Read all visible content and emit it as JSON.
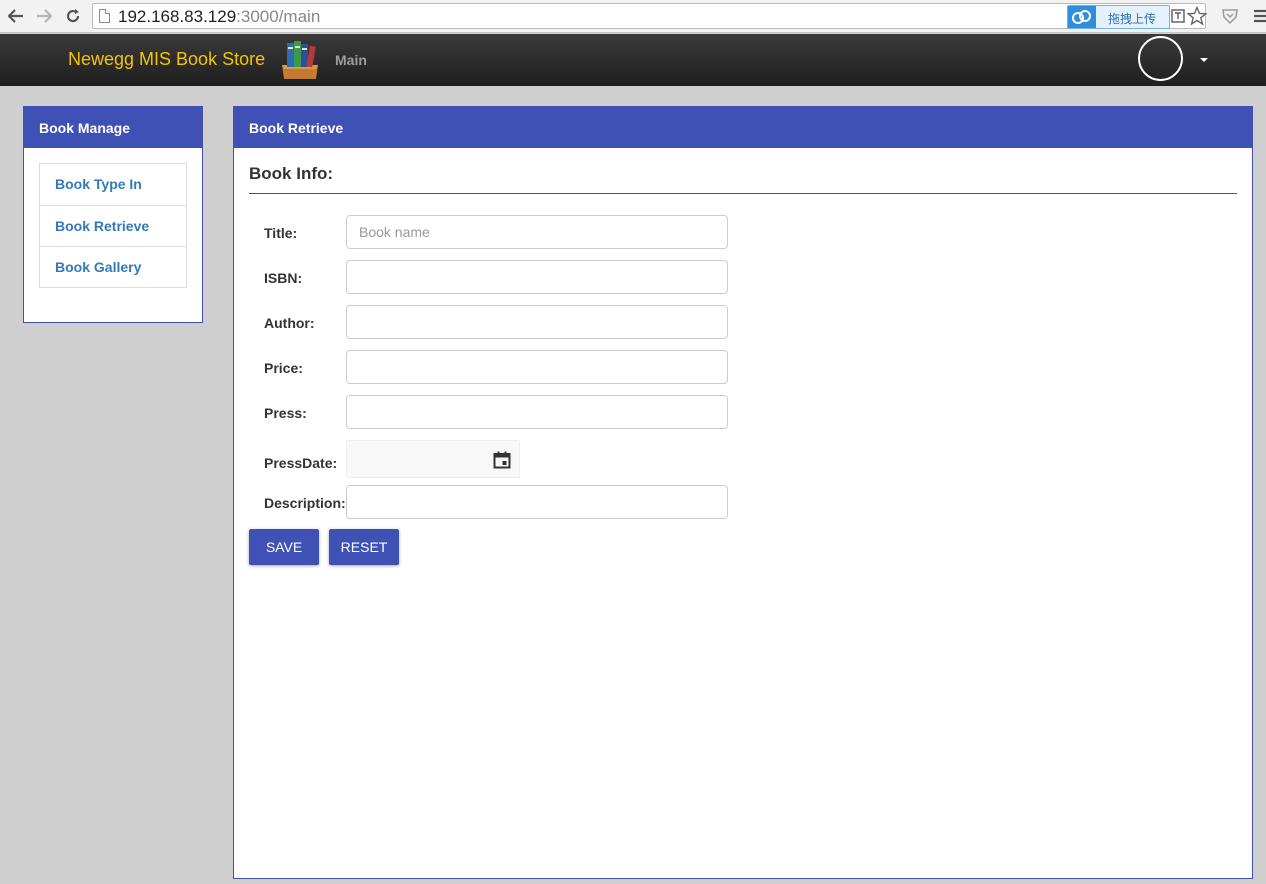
{
  "browser": {
    "url_host": "192.168.83.129",
    "url_rest": ":3000/main",
    "extension_label": "拖拽上传"
  },
  "navbar": {
    "brand": "Newegg MIS Book Store",
    "main_link": "Main"
  },
  "sidebar": {
    "title": "Book Manage",
    "items": [
      {
        "label": "Book Type In"
      },
      {
        "label": "Book Retrieve"
      },
      {
        "label": "Book Gallery"
      }
    ]
  },
  "main": {
    "title": "Book Retrieve",
    "section_title": "Book Info:",
    "form": {
      "title_label": "Title:",
      "title_placeholder": "Book name",
      "isbn_label": "ISBN:",
      "author_label": "Author:",
      "price_label": "Price:",
      "press_label": "Press:",
      "pressdate_label": "PressDate:",
      "description_label": "Description:"
    },
    "buttons": {
      "save": "SAVE",
      "reset": "RESET"
    }
  },
  "colors": {
    "primary": "#3f51b5",
    "brand": "#f5c400",
    "link": "#337ab7"
  },
  "icons": [
    "back-arrow-icon",
    "forward-arrow-icon",
    "reload-icon",
    "page-icon",
    "cloud-upload-icon",
    "translate-icon",
    "star-icon",
    "shield-icon",
    "menu-icon",
    "books-logo-icon",
    "calendar-icon",
    "chevron-down-icon"
  ]
}
